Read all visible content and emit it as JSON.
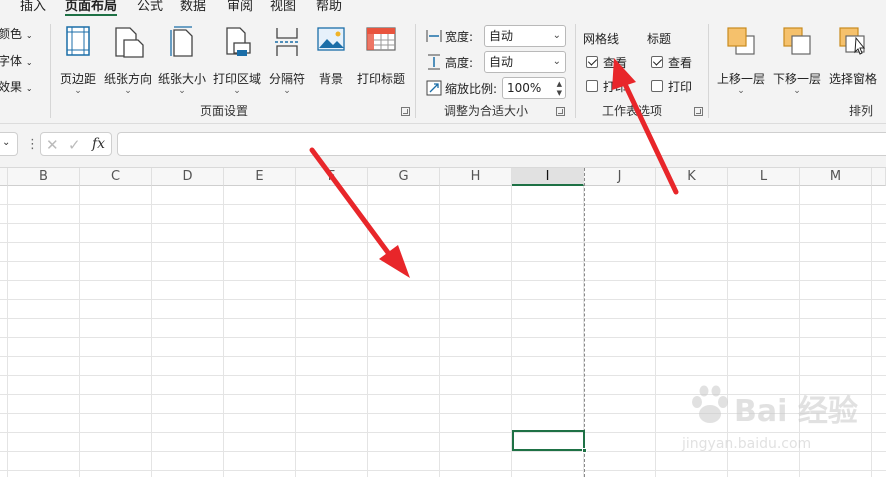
{
  "menu": {
    "tabs": [
      {
        "label": "插入"
      },
      {
        "label": "页面布局",
        "active": true
      },
      {
        "label": "公式"
      },
      {
        "label": "数据"
      },
      {
        "label": "审阅"
      },
      {
        "label": "视图"
      },
      {
        "label": "帮助"
      }
    ]
  },
  "theme_group": {
    "items": [
      "颜色",
      "字体",
      "效果"
    ]
  },
  "page_setup": {
    "label": "页面设置",
    "buttons": [
      {
        "label": "页边距",
        "icon": "margins-icon"
      },
      {
        "label": "纸张方向",
        "icon": "orientation-icon"
      },
      {
        "label": "纸张大小",
        "icon": "paper-size-icon"
      },
      {
        "label": "打印区域",
        "icon": "print-area-icon"
      },
      {
        "label": "分隔符",
        "icon": "breaks-icon"
      },
      {
        "label": "背景",
        "icon": "background-icon"
      },
      {
        "label": "打印标题",
        "icon": "print-titles-icon"
      }
    ]
  },
  "scale_to_fit": {
    "label": "调整为合适大小",
    "width_label": "宽度:",
    "width_value": "自动",
    "height_label": "高度:",
    "height_value": "自动",
    "scale_label": "缩放比例:",
    "scale_value": "100%"
  },
  "sheet_options": {
    "label": "工作表选项",
    "gridlines": {
      "title": "网格线",
      "view_label": "查看",
      "view_checked": true,
      "print_label": "打印",
      "print_checked": false
    },
    "headings": {
      "title": "标题",
      "view_label": "查看",
      "view_checked": true,
      "print_label": "打印",
      "print_checked": false
    }
  },
  "arrange": {
    "label": "排列",
    "buttons": [
      {
        "label": "上移一层",
        "icon": "bring-forward-icon"
      },
      {
        "label": "下移一层",
        "icon": "send-backward-icon"
      },
      {
        "label": "选择窗格",
        "icon": "selection-pane-icon"
      }
    ]
  },
  "formula_bar": {
    "fx_label": "fx",
    "value": ""
  },
  "columns": [
    "B",
    "C",
    "D",
    "E",
    "F",
    "G",
    "H",
    "I",
    "J",
    "K",
    "L",
    "M"
  ],
  "selected_column": "I",
  "watermark": {
    "text": "Bai 经验",
    "url": "jingyan.baidu.com"
  },
  "colors": {
    "accent": "#1e7145",
    "arrow": "#e8262a"
  }
}
